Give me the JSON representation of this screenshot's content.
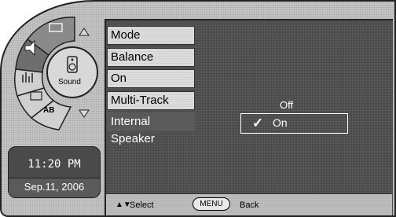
{
  "menu": {
    "items": [
      "Mode",
      "Balance",
      "On",
      "Multi-Track",
      "Internal Speaker"
    ]
  },
  "options": {
    "off": "Off",
    "on": "On"
  },
  "dial": {
    "center_label": "Sound",
    "ab_label": "AB"
  },
  "clock": {
    "time": "11:20 PM",
    "date": "Sep.11, 2006"
  },
  "footer": {
    "arrows": "▲▼",
    "select_label": "Select",
    "menu_button": "MENU",
    "back_label": "Back"
  }
}
